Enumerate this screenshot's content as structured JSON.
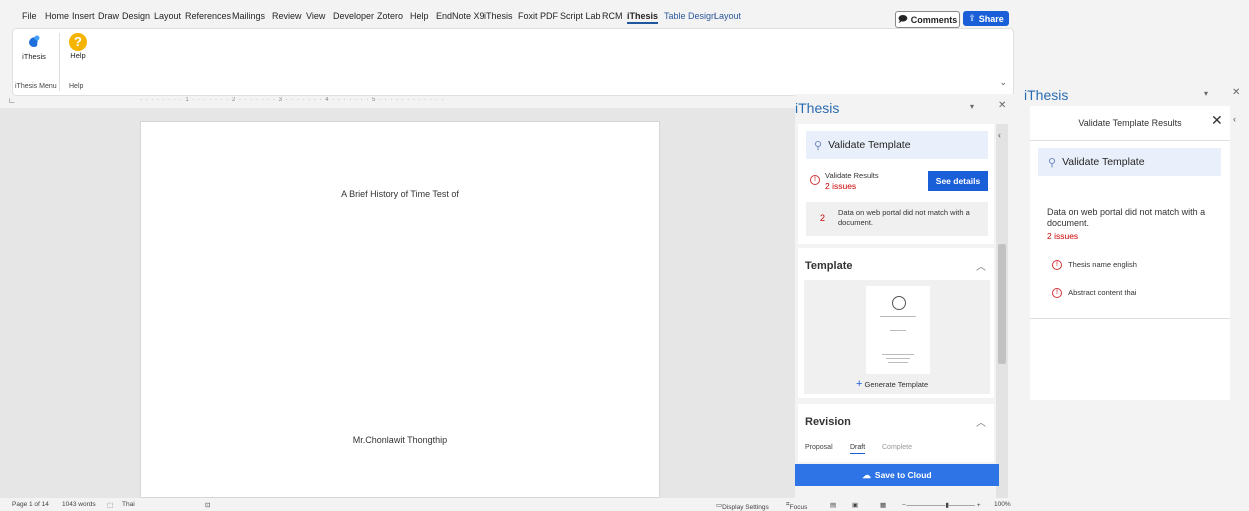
{
  "menubar": {
    "tabs": [
      "File",
      "Home",
      "Insert",
      "Draw",
      "Design",
      "Layout",
      "References",
      "Mailings",
      "Review",
      "View",
      "Developer",
      "Zotero",
      "Help",
      "EndNote X9",
      "iThesis",
      "Foxit PDF",
      "Script Lab",
      "RCM",
      "iThesis",
      "Table Design",
      "Layout"
    ],
    "comments_label": "Comments",
    "share_label": "Share"
  },
  "ribbon": {
    "ithesis_label": "iThesis",
    "help_label": "Help",
    "group_ithesis_menu": "iThesis Menu",
    "group_help": "Help"
  },
  "ruler": {
    "text": "· · · · · · · · 1 · · · · · · · 2 · · · · · · · 3 · · · · · · · 4 · · · · · · · 5 · · · · · · · · · · · ·"
  },
  "document": {
    "title_line": "A Brief History of Time Test of",
    "author_line": "Mr.Chonlawit Thongthip"
  },
  "statusbar": {
    "page": "Page 1 of 14",
    "words": "1043 words",
    "language": "Thai",
    "display_settings": "Display Settings",
    "focus": "Focus",
    "zoom": "100%"
  },
  "pane1": {
    "title": "iThesis",
    "validate_template": "Validate Template",
    "validate_results": "Validate Results",
    "issues": "2 issues",
    "see_details": "See details",
    "issue_count": "2",
    "issue_message": "Data on web portal did not match with a document.",
    "template_section": "Template",
    "generate_template": "Generate Template",
    "revision_section": "Revision",
    "revision_tabs": [
      "Proposal",
      "Draft",
      "Complete"
    ],
    "save_to_cloud": "Save to Cloud"
  },
  "pane2": {
    "title": "iThesis",
    "header": "Validate Template Results",
    "validate_template": "Validate Template",
    "message": "Data on web portal did not match with a document.",
    "issues": "2 issues",
    "items": [
      "Thesis name english",
      "Abstract content thai"
    ]
  },
  "colors": {
    "accent": "#1a5ed8",
    "title_blue": "#2b6cb0",
    "error": "#c00000"
  }
}
